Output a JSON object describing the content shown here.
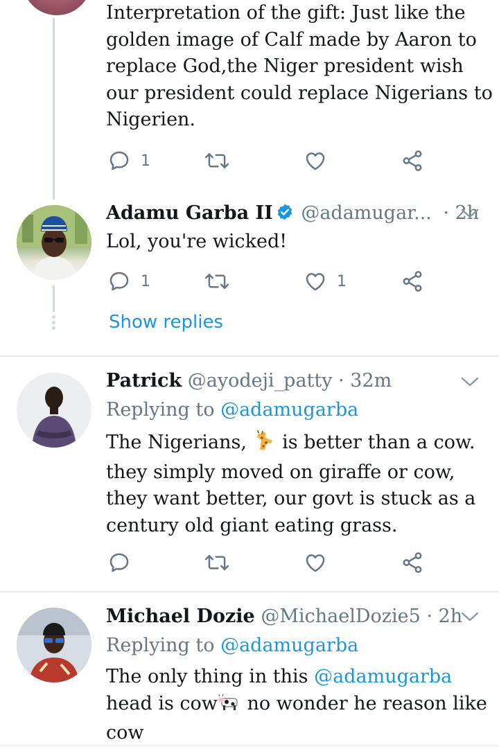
{
  "tweet1": {
    "text": "Interpretation of the gift:  Just like the golden  image of Calf made by Aaron to replace God,the Niger president wish our president could replace Nigerians to Nigerien.",
    "reply_count": "1",
    "retweet_count": "",
    "like_count": ""
  },
  "tweet2": {
    "name": "Adamu Garba II",
    "handle": "@adamugar...",
    "time": "· 2h",
    "text": "Lol, you're wicked!",
    "reply_count": "1",
    "like_count": "1",
    "show_replies": "Show replies",
    "verified_icon": "verified-badge-icon",
    "accent": "#1b95e0"
  },
  "tweet3": {
    "name": "Patrick",
    "handle": "@ayodeji_patty",
    "time": "· 32m",
    "replying_prefix": "Replying to",
    "replying_handle": "@adamugarba",
    "text_part1": "The Nigerians, ",
    "emoji1": "giraffe-emoji",
    "text_part2": " is better than a cow. they simply moved on giraffe or cow, they want better, our govt is stuck as a century old giant eating grass."
  },
  "tweet4": {
    "name": "Michael Dozie",
    "handle": "@MichaelDozie5",
    "time": "· 2h",
    "replying_prefix": "Replying to",
    "replying_handle": "@adamugarba",
    "text_part1": "The only thing in this ",
    "mention": "@adamugarba",
    "text_part2": " head is cow",
    "emoji1": "cow-emoji",
    "text_part3": " no wonder he reason like cow"
  }
}
